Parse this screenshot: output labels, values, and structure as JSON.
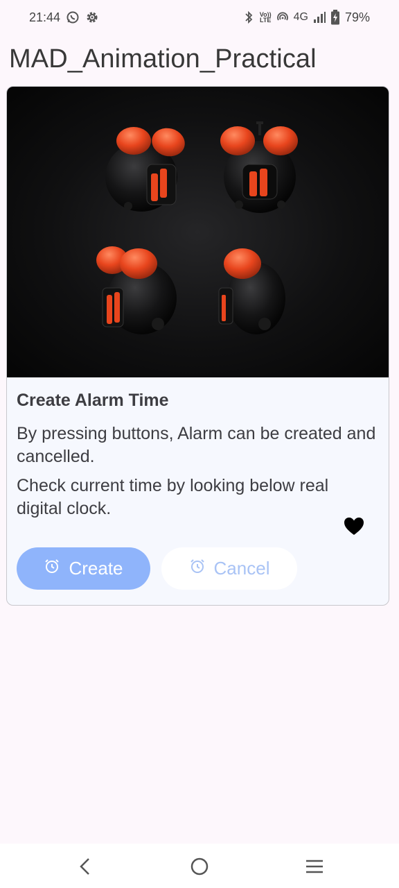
{
  "status_bar": {
    "time": "21:44",
    "network": "4G",
    "battery": "79%",
    "volte_top": "Vo))",
    "volte_bottom": "LTE",
    "left_icons": [
      "whatsapp-icon",
      "settings-gear-icon"
    ],
    "right_icons": [
      "bluetooth-icon",
      "volte-icon",
      "hotspot-icon",
      "signal-icon",
      "battery-charging-icon"
    ]
  },
  "app": {
    "title": "MAD_Animation_Practical"
  },
  "card": {
    "image_description_icon": "alarm-clocks-image",
    "title": "Create Alarm Time",
    "text1": "By pressing buttons, Alarm can be created and cancelled.",
    "text2": "Check current time by looking below real digital clock.",
    "favorite_icon": "heart-icon",
    "create_label": "Create",
    "cancel_label": "Cancel",
    "button_icon": "alarm-icon"
  },
  "colors": {
    "background": "#fdf7fc",
    "card": "#f6f8fe",
    "primary": "#8fb4fb",
    "cancel_text": "#a9c3f5",
    "clock_accent": "#e8451d"
  },
  "nav_bar": {
    "icons": [
      "back-icon",
      "home-icon",
      "menu-icon"
    ]
  }
}
